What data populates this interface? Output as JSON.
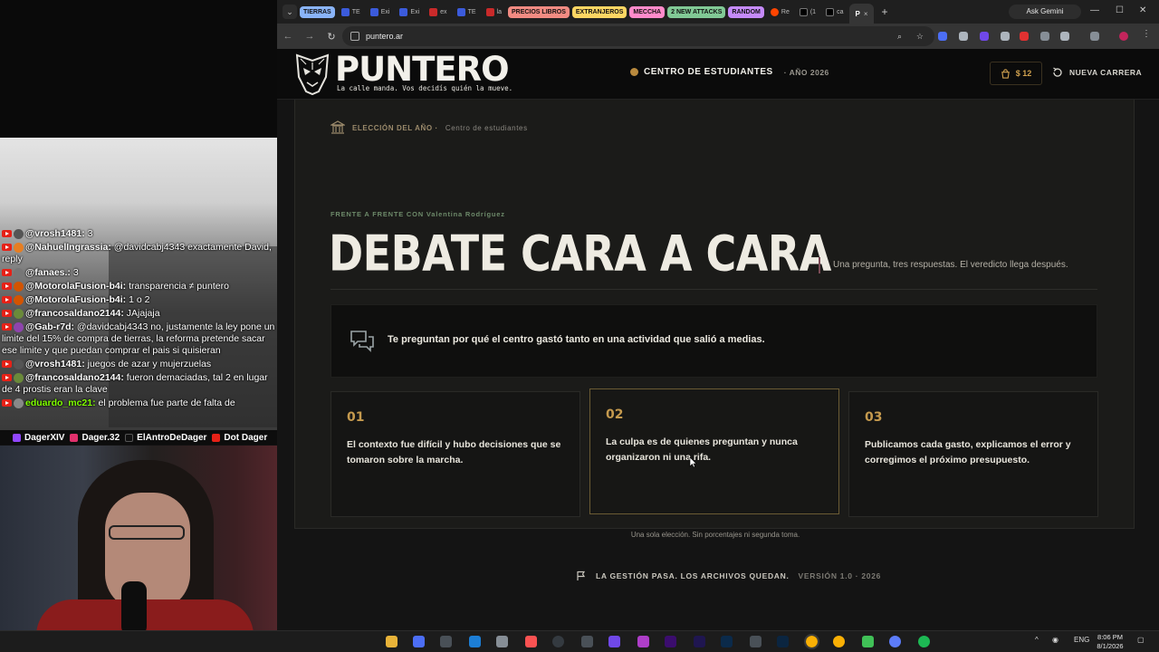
{
  "stream": {
    "chat": [
      {
        "user": "@vrosh1481:",
        "msg": "3",
        "color": "#ffffff",
        "avatar": "#555"
      },
      {
        "user": "@NahuelIngrassia:",
        "msg": "@davidcabj4343 exactamente David, reply",
        "color": "#ffffff",
        "avatar": "#e67e22"
      },
      {
        "user": "@fanaes.:",
        "msg": "3",
        "color": "#ffffff",
        "avatar": "#777"
      },
      {
        "user": "@MotorolaFusion-b4i:",
        "msg": "transparencia ≠ puntero",
        "color": "#ffffff",
        "avatar": "#d35400"
      },
      {
        "user": "@MotorolaFusion-b4i:",
        "msg": "1 o 2",
        "color": "#ffffff",
        "avatar": "#d35400"
      },
      {
        "user": "@francosaldano2144:",
        "msg": "JAjajaja",
        "color": "#ffffff",
        "avatar": "#6a8a3a"
      },
      {
        "user": "@Gab-r7d:",
        "msg": "@davidcabj4343 no, justamente la ley pone un limite del 15% de compra de tierras, la reforma pretende sacar ese limite y que puedan comprar el pais si quisieran",
        "color": "#ffffff",
        "avatar": "#8e44ad"
      },
      {
        "user": "@vrosh1481:",
        "msg": "juegos de azar y mujerzuelas",
        "color": "#ffffff",
        "avatar": "#555"
      },
      {
        "user": "@francosaldano2144:",
        "msg": "fueron demaciadas, tal 2 en lugar de 4 prostis eran la clave",
        "color": "#ffffff",
        "avatar": "#6a8a3a"
      },
      {
        "user": "eduardo_mc21:",
        "msg": "el problema fue parte de falta de",
        "color": "#7fff00",
        "avatar": "#888"
      }
    ],
    "socials": [
      "DagerXIV",
      "Dager.32",
      "ElAntroDeDager",
      "Dot Dager"
    ]
  },
  "browser": {
    "tab_groups": [
      {
        "label": "TIERRAS",
        "color": "#8ab4f8"
      },
      {
        "label": "PRECIOS LIBROS",
        "color": "#f28b82"
      },
      {
        "label": "EXTRANJEROS",
        "color": "#fdd663"
      },
      {
        "label": "MECCHA",
        "color": "#ff8bcb"
      },
      {
        "label": "2 NEW ATTACKS",
        "color": "#81c995"
      },
      {
        "label": "RANDOM",
        "color": "#c58af9"
      }
    ],
    "tabs_a": [
      "TE",
      "Exi",
      "Exi",
      "ex"
    ],
    "tabs_b": [
      "TE",
      "la"
    ],
    "tabs_c": [
      "Re",
      "(1",
      "ca"
    ],
    "active_tab": "P",
    "new_tab": "+",
    "gemini": "Ask Gemini",
    "url": "puntero.ar"
  },
  "site": {
    "logo": "PUNTERO",
    "tagline": "La calle manda. Vos decidís quién la mueve.",
    "center": "CENTRO DE ESTUDIANTES",
    "year": "· AÑO 2026",
    "cart": "$ 12",
    "new_race": "NUEVA CARRERA",
    "eyebrow_main": "ELECCIÓN DEL AÑO ·",
    "eyebrow_ctr": "Centro de estudiantes",
    "kicker": "FRENTE A FRENTE CON Valentina Rodríguez",
    "headline": "DEBATE CARA A CARA",
    "subline": "Una pregunta, tres respuestas. El veredicto llega después.",
    "question": "Te preguntan por qué el centro gastó tanto en una actividad que salió a medias.",
    "options": [
      {
        "num": "01",
        "text": "El contexto fue difícil y hubo decisiones que se tomaron sobre la marcha."
      },
      {
        "num": "02",
        "text": "La culpa es de quienes preguntan y nunca organizaron ni una rifa."
      },
      {
        "num": "03",
        "text": "Publicamos cada gasto, explicamos el error y corregimos el próximo presupuesto."
      }
    ],
    "footnote": "Una sola elección. Sin porcentajes ni segunda toma.",
    "footer": "LA GESTIÓN PASA. LOS ARCHIVOS QUEDAN.",
    "version": "VERSIÓN 1.0 · 2026"
  },
  "taskbar": {
    "lang": "ENG",
    "time": "8:06 PM",
    "date": "8/1/2026"
  }
}
